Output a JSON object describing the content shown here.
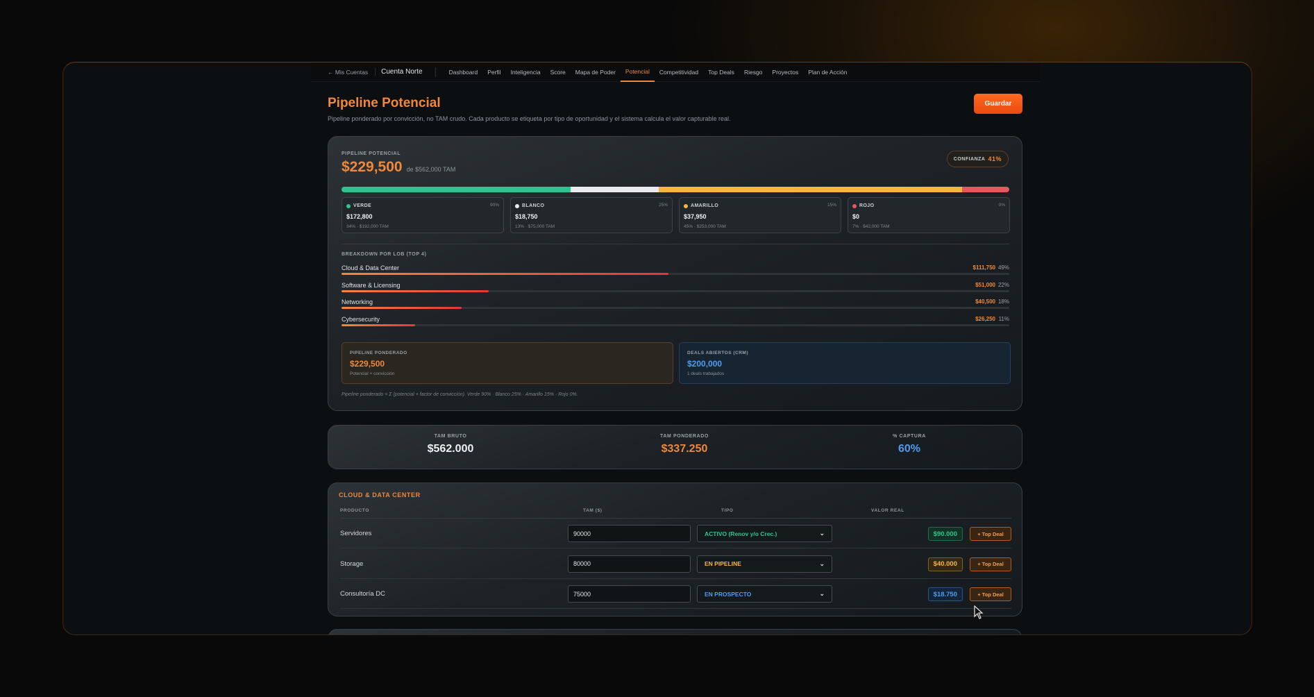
{
  "nav": {
    "back": "← Mis Cuentas",
    "account": "Cuenta Norte",
    "tabs": [
      "Dashboard",
      "Perfil",
      "Inteligencia",
      "Score",
      "Mapa de Poder",
      "Potencial",
      "Competitividad",
      "Top Deals",
      "Riesgo",
      "Proyectos",
      "Plan de Acción"
    ],
    "active_tab": "Potencial"
  },
  "page": {
    "title": "Pipeline Potencial",
    "subtitle": "Pipeline ponderado por convicción, no TAM crudo. Cada producto se etiqueta por tipo de oportunidad y el sistema calcula el valor capturable real.",
    "save_label": "Guardar"
  },
  "pipeline": {
    "label": "PIPELINE POTENCIAL",
    "value": "$229,500",
    "of_tam": "de $562,000 TAM",
    "confidence_label": "CONFIANZA",
    "confidence_value": "41%",
    "segments": [
      {
        "color": "#2fc48f",
        "fraction": 0.34
      },
      {
        "color": "#e9ecef",
        "fraction": 0.13
      },
      {
        "color": "#f6b63e",
        "fraction": 0.45
      },
      {
        "color": "#e4585e",
        "fraction": 0.07
      }
    ],
    "buckets": [
      {
        "name": "VERDE",
        "color": "#2fc48f",
        "pct": "90%",
        "value": "$172,800",
        "detail": "34% · $192,000 TAM"
      },
      {
        "name": "BLANCO",
        "color": "#e9ecef",
        "pct": "25%",
        "value": "$18,750",
        "detail": "13% · $75,000 TAM"
      },
      {
        "name": "AMARILLO",
        "color": "#f6b63e",
        "pct": "15%",
        "value": "$37,950",
        "detail": "45% · $253,000 TAM"
      },
      {
        "name": "ROJO",
        "color": "#e4585e",
        "pct": "0%",
        "value": "$0",
        "detail": "7% · $42,000 TAM"
      }
    ],
    "lob_label": "BREAKDOWN POR LOB (TOP 4)",
    "lobs": [
      {
        "name": "Cloud & Data Center",
        "value": "$111,750",
        "pct": "49%",
        "fraction": 0.49
      },
      {
        "name": "Software & Licensing",
        "value": "$51,000",
        "pct": "22%",
        "fraction": 0.22
      },
      {
        "name": "Networking",
        "value": "$40,500",
        "pct": "18%",
        "fraction": 0.18
      },
      {
        "name": "Cybersecurity",
        "value": "$26,250",
        "pct": "11%",
        "fraction": 0.11
      }
    ],
    "weighted": {
      "label": "PIPELINE PONDERADO",
      "value": "$229,500",
      "sub": "Potencial × convicción"
    },
    "open_deals": {
      "label": "DEALS ABIERTOS (CRM)",
      "value": "$200,000",
      "sub": "1 deals trabajados"
    },
    "footnote": "Pipeline ponderado = Σ (potencial × factor de convicción). Verde 90% · Blanco 25% · Amarillo 15% · Rojo 0%."
  },
  "tam": {
    "bruto_label": "TAM BRUTO",
    "bruto_value": "$562.000",
    "ponderado_label": "TAM PONDERADO",
    "ponderado_value": "$337.250",
    "captura_label": "% CAPTURA",
    "captura_value": "60%"
  },
  "cloud": {
    "title": "CLOUD & DATA CENTER",
    "headers": {
      "producto": "PRODUCTO",
      "tam": "TAM ($)",
      "tipo": "TIPO",
      "valor": "VALOR REAL"
    },
    "top_deal_label": "+ Top Deal",
    "rows": [
      {
        "name": "Servidores",
        "tam": "90000",
        "tipo": "ACTIVO (Renov y/o Crec.)",
        "tipo_color": "#2fc48f",
        "valor": "$90.000",
        "valor_color": "#2fc48f",
        "valor_bg": "#123226"
      },
      {
        "name": "Storage",
        "tam": "80000",
        "tipo": "EN PIPELINE",
        "tipo_color": "#f6b63e",
        "valor": "$40.000",
        "valor_color": "#f6b63e",
        "valor_bg": "#352812"
      },
      {
        "name": "Consultoría DC",
        "tam": "75000",
        "tipo": "EN PROSPECTO",
        "tipo_color": "#4f9cf0",
        "valor": "$18.750",
        "valor_color": "#4f9cf0",
        "valor_bg": "#13253a"
      }
    ]
  }
}
